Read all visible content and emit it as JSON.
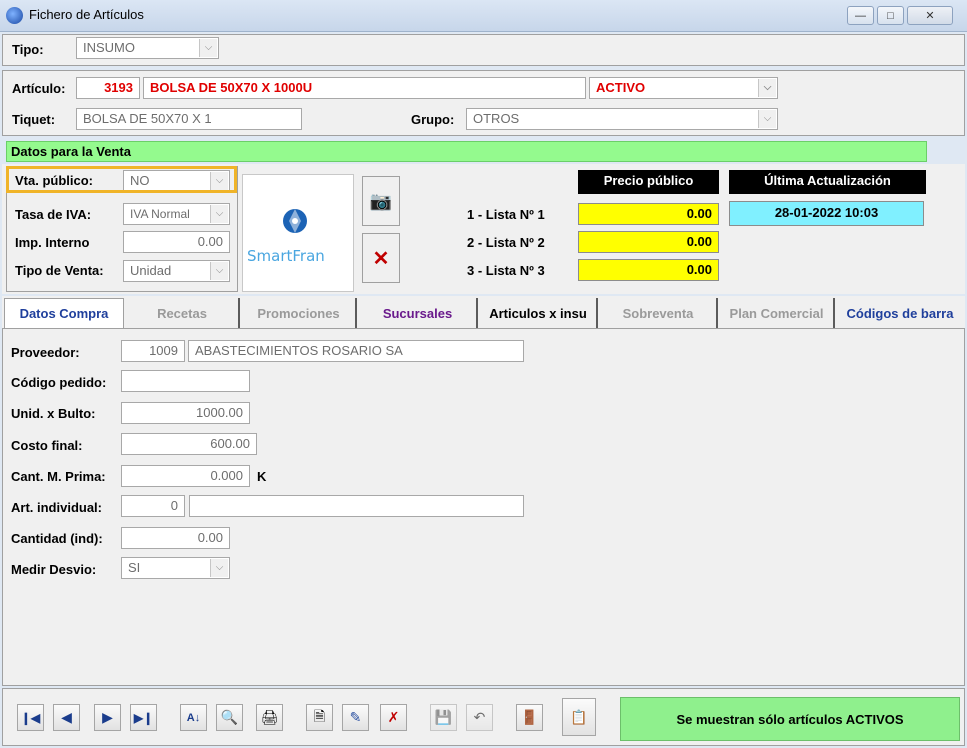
{
  "window": {
    "title": "Fichero de Artículos"
  },
  "tipo": {
    "label": "Tipo:",
    "value": "INSUMO"
  },
  "articulo": {
    "label": "Artículo:",
    "code": "3193",
    "name": "BOLSA DE 50X70 X 1000U",
    "status": "ACTIVO",
    "tiquet_label": "Tiquet:",
    "tiquet": "BOLSA DE 50X70 X 1",
    "grupo_label": "Grupo:",
    "grupo": "OTROS"
  },
  "venta": {
    "header": "Datos para la Venta",
    "vta_publico_label": "Vta. público:",
    "vta_publico": "NO",
    "tasa_iva_label": "Tasa de IVA:",
    "tasa_iva": "IVA Normal",
    "imp_interno_label": "Imp. Interno",
    "imp_interno": "0.00",
    "tipo_venta_label": "Tipo de Venta:",
    "tipo_venta": "Unidad",
    "logo_text": "SmartFran",
    "precio_header": "Precio público",
    "actualizacion_header": "Última Actualización",
    "actualizacion": "28-01-2022 10:03",
    "listas": [
      {
        "label": "1 - Lista Nº 1",
        "value": "0.00"
      },
      {
        "label": "2 - Lista Nº 2",
        "value": "0.00"
      },
      {
        "label": "3 - Lista Nº 3",
        "value": "0.00"
      }
    ]
  },
  "tabs": [
    "Datos Compra",
    "Recetas",
    "Promociones",
    "Sucursales",
    "Articulos x insu",
    "Sobreventa",
    "Plan Comercial",
    "Códigos de barra"
  ],
  "compra": {
    "proveedor_label": "Proveedor:",
    "proveedor_code": "1009",
    "proveedor_name": "ABASTECIMIENTOS ROSARIO SA",
    "codigo_pedido_label": "Código pedido:",
    "codigo_pedido": "",
    "unid_bulto_label": "Unid. x Bulto:",
    "unid_bulto": "1000.00",
    "costo_final_label": "Costo final:",
    "costo_final": "600.00",
    "cant_mprima_label": "Cant. M. Prima:",
    "cant_mprima": "0.000",
    "cant_mprima_unit": "K",
    "art_individual_label": "Art. individual:",
    "art_individual_code": "0",
    "art_individual_name": "",
    "cantidad_ind_label": "Cantidad (ind):",
    "cantidad_ind": "0.00",
    "medir_desvio_label": "Medir Desvio:",
    "medir_desvio": "SI"
  },
  "status_button": "Se muestran sólo artículos ACTIVOS",
  "colors": {
    "green": "#94fa8e",
    "yellow": "#ffff00",
    "cyan": "#80f0ff",
    "red": "#e00000",
    "highlight": "#f0b428"
  }
}
